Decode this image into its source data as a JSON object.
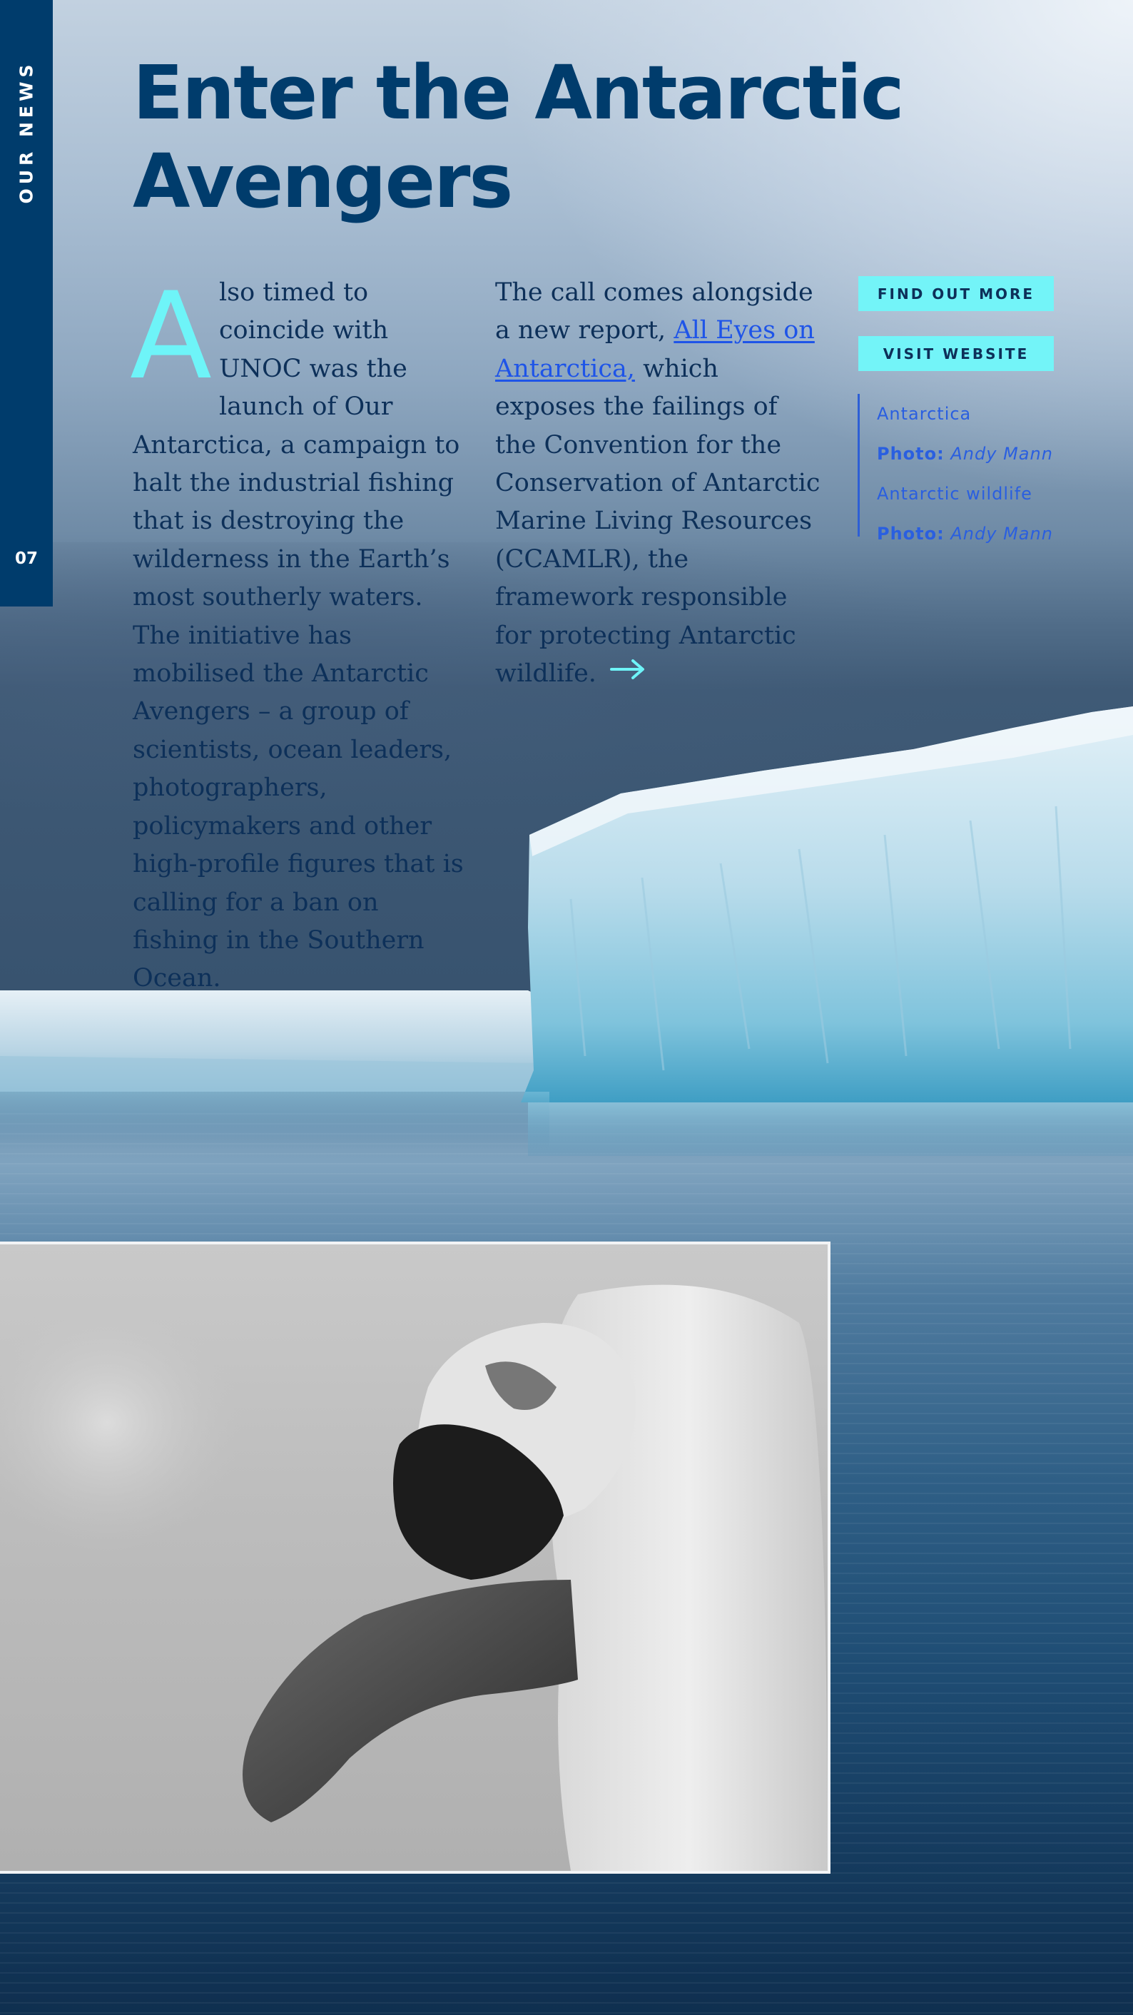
{
  "section_label": "OUR NEWS",
  "page_number": "07",
  "headline": "Enter the Antarctic Avengers",
  "column1": {
    "drop_cap": "A",
    "text": "lso timed to coincide with UNOC was the launch of Our Antarctica, a campaign to halt the industrial fishing that is destroying the wilderness in the Earth’s most southerly waters. The initiative has mobilised the Antarctic Avengers – a group of scientists, ocean leaders, photographers, policymakers and other high-profile figures that is calling for a ban on fishing in the Southern Ocean."
  },
  "column2": {
    "text_before": "The call comes alongside a new report, ",
    "link_text": "All Eyes on Antarctica,",
    "text_after": " which exposes the failings of the Convention for the Conservation of Antarctic Marine Living Resources (CCAMLR), the framework responsible for protecting Antarctic wildlife.",
    "arrow_icon": "arrow-right-icon"
  },
  "buttons": {
    "find_out_more": "FIND OUT MORE",
    "visit_website": "VISIT WEBSITE"
  },
  "captions": [
    {
      "text": "Antarctica"
    },
    {
      "label": "Photo:",
      "credit": "Andy Mann"
    },
    {
      "text": "Antarctic wildlife"
    },
    {
      "label": "Photo:",
      "credit": "Andy Mann"
    }
  ],
  "colors": {
    "navy": "#003c6c",
    "accent_cyan": "#73f4f8",
    "link_blue": "#1e54e8",
    "body_text": "#0d3059"
  }
}
